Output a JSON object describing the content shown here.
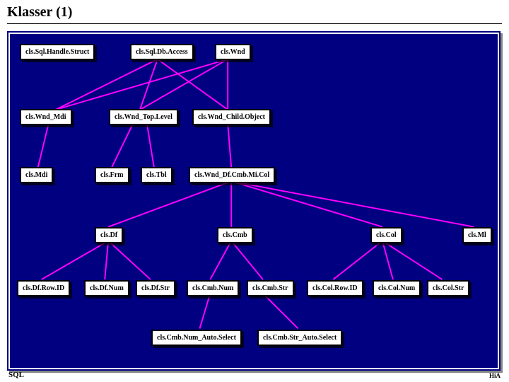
{
  "title": "Klasser (1)",
  "footer": {
    "left": "SQL",
    "right": "HiA"
  },
  "nodes": {
    "sqlHandle": {
      "label": "cls.Sql.Handle.Struct"
    },
    "sqlDbAccess": {
      "label": "cls.Sql.Db.Access"
    },
    "wnd": {
      "label": "cls.Wnd"
    },
    "wndMdi": {
      "label": "cls.Wnd_Mdi"
    },
    "wndTop": {
      "label": "cls.Wnd_Top.Level"
    },
    "wndChild": {
      "label": "cls.Wnd_Child.Object"
    },
    "mdi": {
      "label": "cls.Mdi"
    },
    "frm": {
      "label": "cls.Frm"
    },
    "tbl": {
      "label": "cls.Tbl"
    },
    "wndDfCmb": {
      "label": "cls.Wnd_Df.Cmb.Mi.Col"
    },
    "df": {
      "label": "cls.Df"
    },
    "cmb": {
      "label": "cls.Cmb"
    },
    "col": {
      "label": "cls.Col"
    },
    "ml": {
      "label": "cls.Ml"
    },
    "dfRowId": {
      "label": "cls.Df.Row.ID"
    },
    "dfNum": {
      "label": "cls.Df.Num"
    },
    "dfStr": {
      "label": "cls.Df.Str"
    },
    "cmbNum": {
      "label": "cls.Cmb.Num"
    },
    "cmbStr": {
      "label": "cls.Cmb.Str"
    },
    "colRowId": {
      "label": "cls.Col.Row.ID"
    },
    "colNum": {
      "label": "cls.Col.Num"
    },
    "colStr": {
      "label": "cls.Col.Str"
    },
    "cmbNumAuto": {
      "label": "cls.Cmb.Num_Auto.Select"
    },
    "cmbStrAuto": {
      "label": "cls.Cmb.Str_Auto.Select"
    }
  },
  "chart_data": {
    "type": "diagram",
    "title": "Klasser (1)",
    "nodes": [
      "cls.Sql.Handle.Struct",
      "cls.Sql.Db.Access",
      "cls.Wnd",
      "cls.Wnd_Mdi",
      "cls.Wnd_Top.Level",
      "cls.Wnd_Child.Object",
      "cls.Mdi",
      "cls.Frm",
      "cls.Tbl",
      "cls.Wnd_Df.Cmb.Mi.Col",
      "cls.Df",
      "cls.Cmb",
      "cls.Col",
      "cls.Ml",
      "cls.Df.Row.ID",
      "cls.Df.Num",
      "cls.Df.Str",
      "cls.Cmb.Num",
      "cls.Cmb.Str",
      "cls.Col.Row.ID",
      "cls.Col.Num",
      "cls.Col.Str",
      "cls.Cmb.Num_Auto.Select",
      "cls.Cmb.Str_Auto.Select"
    ],
    "edges": [
      [
        "cls.Sql.Db.Access",
        "cls.Wnd_Mdi"
      ],
      [
        "cls.Sql.Db.Access",
        "cls.Wnd_Top.Level"
      ],
      [
        "cls.Sql.Db.Access",
        "cls.Wnd_Child.Object"
      ],
      [
        "cls.Wnd",
        "cls.Wnd_Mdi"
      ],
      [
        "cls.Wnd",
        "cls.Wnd_Top.Level"
      ],
      [
        "cls.Wnd",
        "cls.Wnd_Child.Object"
      ],
      [
        "cls.Wnd_Mdi",
        "cls.Mdi"
      ],
      [
        "cls.Wnd_Top.Level",
        "cls.Frm"
      ],
      [
        "cls.Wnd_Top.Level",
        "cls.Tbl"
      ],
      [
        "cls.Wnd_Child.Object",
        "cls.Wnd_Df.Cmb.Mi.Col"
      ],
      [
        "cls.Wnd_Df.Cmb.Mi.Col",
        "cls.Df"
      ],
      [
        "cls.Wnd_Df.Cmb.Mi.Col",
        "cls.Cmb"
      ],
      [
        "cls.Wnd_Df.Cmb.Mi.Col",
        "cls.Col"
      ],
      [
        "cls.Wnd_Df.Cmb.Mi.Col",
        "cls.Ml"
      ],
      [
        "cls.Df",
        "cls.Df.Row.ID"
      ],
      [
        "cls.Df",
        "cls.Df.Num"
      ],
      [
        "cls.Df",
        "cls.Df.Str"
      ],
      [
        "cls.Cmb",
        "cls.Cmb.Num"
      ],
      [
        "cls.Cmb",
        "cls.Cmb.Str"
      ],
      [
        "cls.Col",
        "cls.Col.Row.ID"
      ],
      [
        "cls.Col",
        "cls.Col.Num"
      ],
      [
        "cls.Col",
        "cls.Col.Str"
      ],
      [
        "cls.Cmb.Num",
        "cls.Cmb.Num_Auto.Select"
      ],
      [
        "cls.Cmb.Str",
        "cls.Cmb.Str_Auto.Select"
      ]
    ]
  }
}
